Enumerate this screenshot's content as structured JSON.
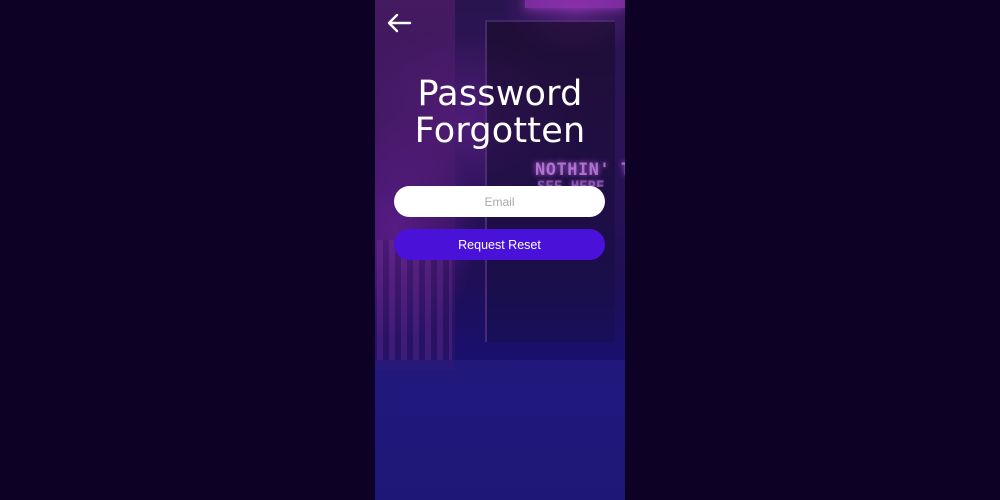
{
  "screen": {
    "title_lines": [
      "Password",
      "Forgotten"
    ],
    "background_sign_text": "NOTHIN' TO",
    "background_sign_text_2": "SEE HERE"
  },
  "nav": {
    "back_icon": "arrow-left-icon"
  },
  "form": {
    "email_placeholder": "Email",
    "email_value": "",
    "submit_label": "Request Reset"
  },
  "colors": {
    "page_background": "#0d0126",
    "primary_button": "#4a12d8",
    "input_background": "#ffffff",
    "title_text": "#ffffff"
  }
}
